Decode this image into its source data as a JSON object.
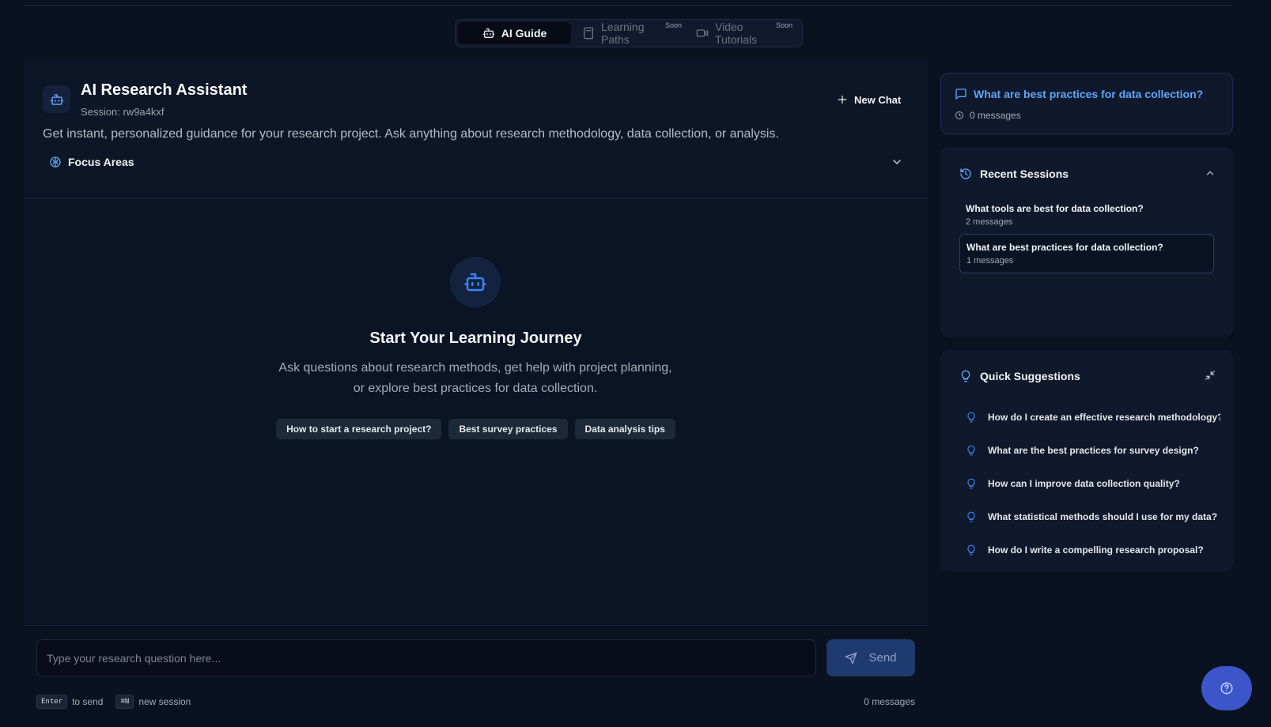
{
  "tabs": [
    {
      "label": "AI Guide",
      "icon": "robot-icon"
    },
    {
      "label": "Learning Paths",
      "badge": "Soon",
      "icon": "book-icon"
    },
    {
      "label": "Video Tutorials",
      "badge": "Soon",
      "icon": "video-icon"
    }
  ],
  "assistant": {
    "title": "AI Research Assistant",
    "session": "Session: rw9a4kxf",
    "new_chat": "New Chat",
    "description": "Get instant, personalized guidance for your research project. Ask anything about research methodology, data collection, or analysis.",
    "focus_areas": "Focus Areas"
  },
  "empty_state": {
    "title": "Start Your Learning Journey",
    "subtitle": "Ask questions about research methods, get help with project planning, or explore best practices for data collection.",
    "chips": [
      "How to start a research project?",
      "Best survey practices",
      "Data analysis tips"
    ]
  },
  "composer": {
    "placeholder": "Type your research question here...",
    "send_label": "Send",
    "enter_key": "Enter",
    "enter_hint": "to send",
    "new_key": "⌘N",
    "new_hint": "new session",
    "message_count": "0 messages"
  },
  "current_session": {
    "title": "What are best practices for data collection?",
    "messages": "0 messages"
  },
  "recent_sessions": {
    "heading": "Recent Sessions",
    "items": [
      {
        "title": "What tools are best for data collection?",
        "count": "2 messages"
      },
      {
        "title": "What are best practices for data collection?",
        "count": "1 messages"
      }
    ]
  },
  "quick_suggestions": {
    "heading": "Quick Suggestions",
    "items": [
      "How do I create an effective research methodology?",
      "What are the best practices for survey design?",
      "How can I improve data collection quality?",
      "What statistical methods should I use for my data?",
      "How do I write a compelling research proposal?"
    ]
  },
  "colors": {
    "accent": "#60a5fa",
    "send_bg": "#1e3a6e",
    "help_bg": "#3c55c9",
    "background": "#0a1120"
  }
}
